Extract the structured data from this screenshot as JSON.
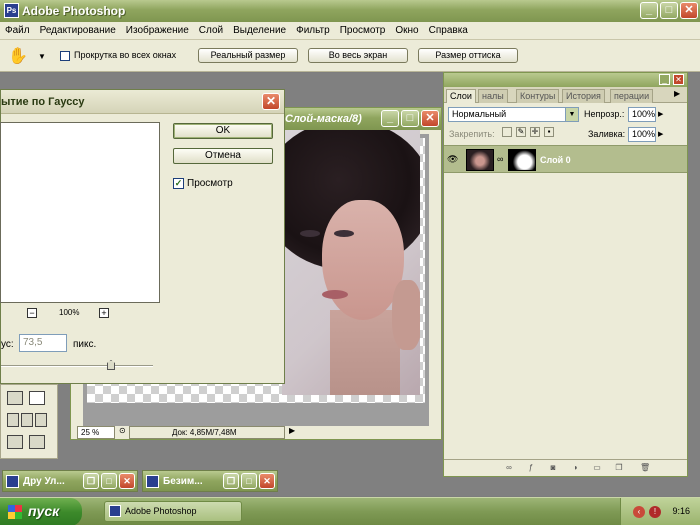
{
  "app": {
    "title": "Adobe Photoshop"
  },
  "menu": [
    "Файл",
    "Редактирование",
    "Изображение",
    "Слой",
    "Выделение",
    "Фильтр",
    "Просмотр",
    "Окно",
    "Справка"
  ],
  "options": {
    "scroll_all_label": "Прокрутка во всех окнах",
    "actual_pixels": "Реальный размер",
    "fit_screen": "Во весь экран",
    "print_size": "Размер оттиска"
  },
  "document": {
    "title": "Слой-маска/8)",
    "zoom": "25 %",
    "doc_info": "Док: 4,85M/7,48M"
  },
  "dialog": {
    "title": "ытие по Гауссу",
    "ok": "OK",
    "cancel": "Отмена",
    "preview_label": "Просмотр",
    "preview_checked": true,
    "zoom_minus": "−",
    "zoom_plus": "+",
    "zoom_pct": "100%",
    "radius_label": "ус:",
    "radius_value": "73,5",
    "radius_unit": "пикс."
  },
  "layers": {
    "tabs": [
      "Слои",
      "налы",
      "Контуры",
      "История",
      "перации"
    ],
    "blend_mode": "Нормальный",
    "opacity_label": "Непрозр.:",
    "opacity_value": "100%",
    "lock_label": "Закрепить:",
    "fill_label": "Заливка:",
    "fill_value": "100%",
    "layer_name": "Слой 0"
  },
  "minimized": [
    "Дру Ул...",
    "Безим..."
  ],
  "taskbar": {
    "start": "пуск",
    "item": "Adobe Photoshop",
    "clock": "9:16"
  }
}
